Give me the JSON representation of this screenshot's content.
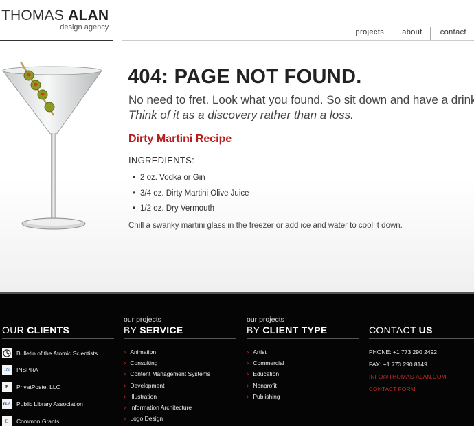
{
  "brand": {
    "name_light": "THOMAS ",
    "name_bold": "ALAN",
    "tagline": "design agency"
  },
  "nav": [
    {
      "label": "projects"
    },
    {
      "label": "about"
    },
    {
      "label": "contact"
    }
  ],
  "main": {
    "heading": "404: PAGE NOT FOUND.",
    "lead1": "No need to fret. Look what you found. So sit down and have a drink.",
    "lead2": "Think of it as a discovery rather than a loss.",
    "recipe_title": "Dirty Martini Recipe",
    "ingredients_label": "INGREDIENTS:",
    "ingredients": [
      "2 oz. Vodka or Gin",
      "3/4 oz. Dirty Martini Olive Juice",
      "1/2 oz. Dry Vermouth"
    ],
    "instruction": "Chill a swanky martini glass in the freezer or add ice and water to cool it down."
  },
  "footer": {
    "clients": {
      "heading_light": "OUR ",
      "heading_bold": "CLIENTS",
      "items": [
        {
          "name": "Bulletin of the Atomic Scientists",
          "icon": "atomic-clock-icon"
        },
        {
          "name": "INSPRA",
          "icon": "inspra-logo-icon",
          "logo_text": "IN"
        },
        {
          "name": "PrivatPoste, LLC",
          "icon": "privatposte-logo-icon",
          "logo_text": "P"
        },
        {
          "name": "Public Library Association",
          "icon": "pla-logo-icon",
          "logo_text": "PLA"
        },
        {
          "name": "Common Grants",
          "icon": "common-grants-logo-icon",
          "logo_text": "G"
        }
      ]
    },
    "service": {
      "small": "our projects",
      "heading_light": "BY ",
      "heading_bold": "SERVICE",
      "items": [
        "Animation",
        "Consulting",
        "Content Management Systems",
        "Development",
        "Illustration",
        "Information Architecture",
        "Logo Design"
      ]
    },
    "client_type": {
      "small": "our projects",
      "heading_light": "BY ",
      "heading_bold": "CLIENT TYPE",
      "items": [
        "Artist",
        "Commercial",
        "Education",
        "Nonprofit",
        "Publishing"
      ]
    },
    "contact": {
      "heading_light": "CONTACT ",
      "heading_bold": "US",
      "phone": "PHONE: +1 773 290 2492",
      "fax": "FAX: +1 773 290 8149",
      "email": "INFO@THOMAS-ALAN.COM",
      "form": "CONTACT FORM"
    }
  },
  "colors": {
    "accent_red": "#b71c1c",
    "footer_bg": "#050505",
    "text": "#333333"
  }
}
